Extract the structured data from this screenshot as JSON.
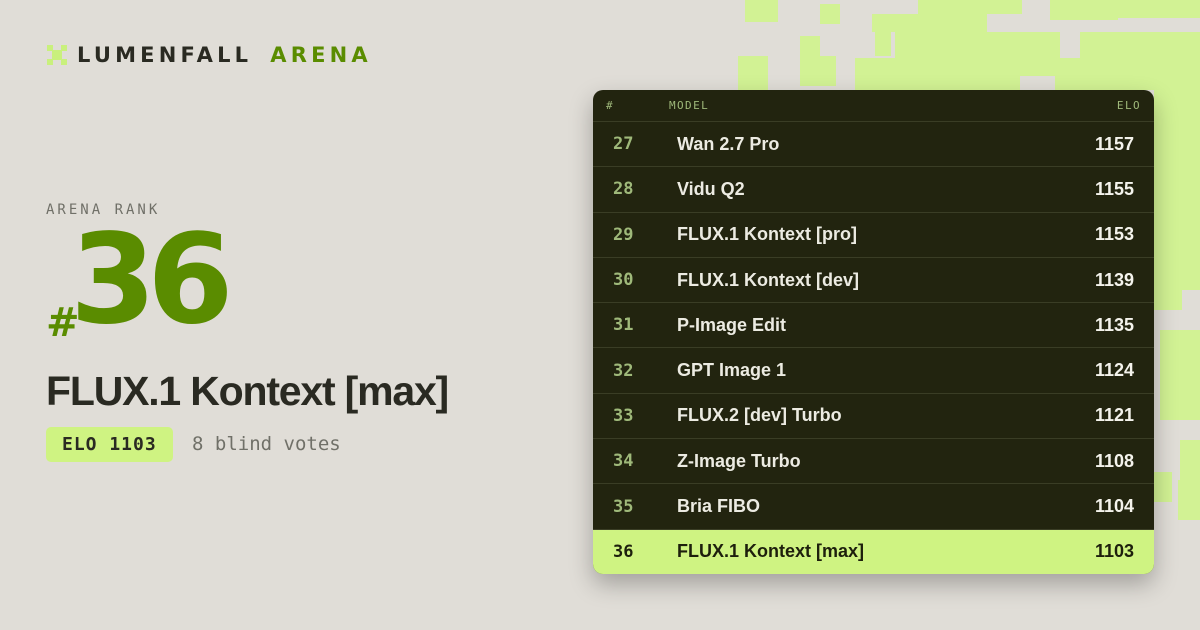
{
  "brand": {
    "name": "LUMENFALL",
    "accent": "ARENA",
    "accent_color": "#5a8c00",
    "mark_icon": "pixel-x-icon"
  },
  "hero": {
    "rank_label": "ARENA RANK",
    "rank_hash": "#",
    "rank_number": "36",
    "model_name": "FLUX.1 Kontext [max]",
    "elo_badge": "ELO 1103",
    "votes": "8 blind votes"
  },
  "leaderboard": {
    "headers": {
      "rank": "#",
      "model": "MODEL",
      "elo": "ELO"
    },
    "rows": [
      {
        "rank": "27",
        "model": "Wan 2.7 Pro",
        "elo": "1157"
      },
      {
        "rank": "28",
        "model": "Vidu Q2",
        "elo": "1155"
      },
      {
        "rank": "29",
        "model": "FLUX.1 Kontext [pro]",
        "elo": "1153"
      },
      {
        "rank": "30",
        "model": "FLUX.1 Kontext [dev]",
        "elo": "1139"
      },
      {
        "rank": "31",
        "model": "P-Image Edit",
        "elo": "1135"
      },
      {
        "rank": "32",
        "model": "GPT Image 1",
        "elo": "1124"
      },
      {
        "rank": "33",
        "model": "FLUX.2 [dev] Turbo",
        "elo": "1121"
      },
      {
        "rank": "34",
        "model": "Z-Image Turbo",
        "elo": "1108"
      },
      {
        "rank": "35",
        "model": "Bria FIBO",
        "elo": "1104"
      },
      {
        "rank": "36",
        "model": "FLUX.1 Kontext [max]",
        "elo": "1103",
        "current": true
      }
    ]
  },
  "colors": {
    "accent_green": "#5a8c00",
    "highlight": "#cff382",
    "board_bg": "#22240f",
    "page_bg": "#e0ddd7",
    "pixel_bg": "#d2f294"
  }
}
